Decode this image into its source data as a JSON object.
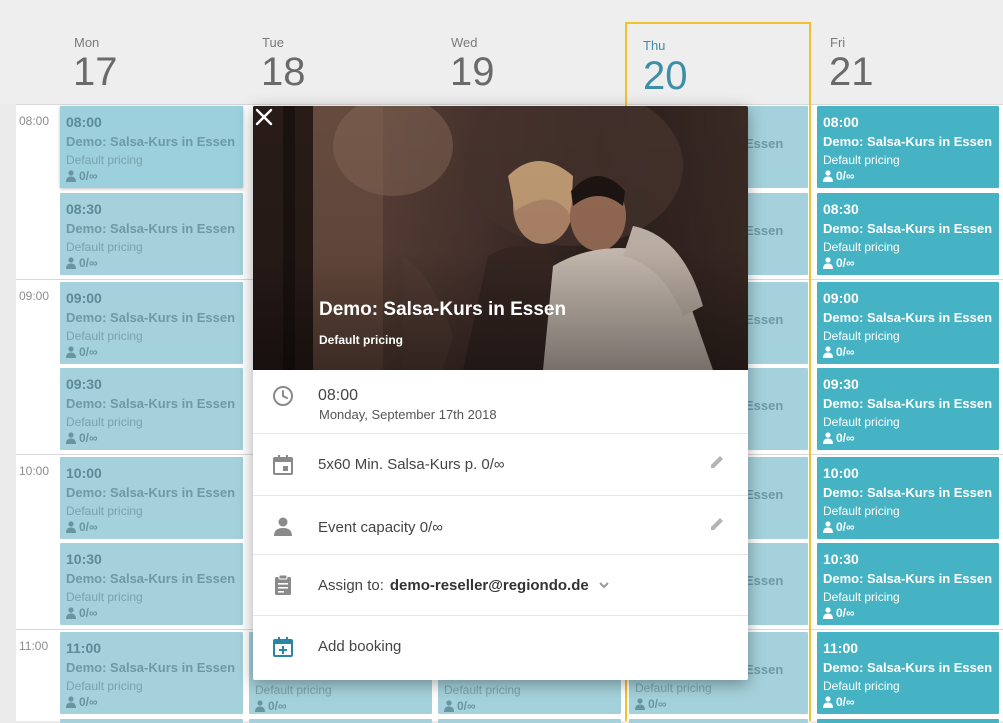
{
  "days": [
    {
      "name": "Mon",
      "num": "17"
    },
    {
      "name": "Tue",
      "num": "18"
    },
    {
      "name": "Wed",
      "num": "19"
    },
    {
      "name": "Thu",
      "num": "20"
    },
    {
      "name": "Fri",
      "num": "21"
    }
  ],
  "times": [
    "08:00",
    "09:00",
    "10:00",
    "11:00"
  ],
  "events": [
    {
      "time": "08:00",
      "name": "Demo: Salsa-Kurs in Essen",
      "pricing": "Default pricing",
      "capacity": "0/∞"
    },
    {
      "time": "08:30",
      "name": "Demo: Salsa-Kurs in Essen",
      "pricing": "Default pricing",
      "capacity": "0/∞"
    },
    {
      "time": "09:00",
      "name": "Demo: Salsa-Kurs in Essen",
      "pricing": "Default pricing",
      "capacity": "0/∞"
    },
    {
      "time": "09:30",
      "name": "Demo: Salsa-Kurs in Essen",
      "pricing": "Default pricing",
      "capacity": "0/∞"
    },
    {
      "time": "10:00",
      "name": "Demo: Salsa-Kurs in Essen",
      "pricing": "Default pricing",
      "capacity": "0/∞"
    },
    {
      "time": "10:30",
      "name": "Demo: Salsa-Kurs in Essen",
      "pricing": "Default pricing",
      "capacity": "0/∞"
    },
    {
      "time": "11:00",
      "name": "Demo: Salsa-Kurs in Essen",
      "pricing": "Default pricing",
      "capacity": "0/∞"
    }
  ],
  "partial_name": "Essen",
  "popup": {
    "title": "Demo: Salsa-Kurs in Essen",
    "pricing": "Default pricing",
    "time": "08:00",
    "date": "Monday, September 17th 2018",
    "ticket": "5x60 Min. Salsa-Kurs p. 0/∞",
    "capacity": "Event capacity 0/∞",
    "assign_label": "Assign to:",
    "assign_value": "demo-reseller@regiondo.de",
    "add_booking": "Add booking"
  },
  "colors": {
    "event_bg": "#9fd5df",
    "event_fri_bg": "#45b3c3",
    "today_accent": "#3d8ea7",
    "today_border": "#f2c12e",
    "link": "#2b86a3"
  },
  "icons": [
    "close-icon",
    "clock-icon",
    "calendar-icon",
    "person-icon",
    "clipboard-icon",
    "calendar-add-icon",
    "pencil-icon"
  ]
}
